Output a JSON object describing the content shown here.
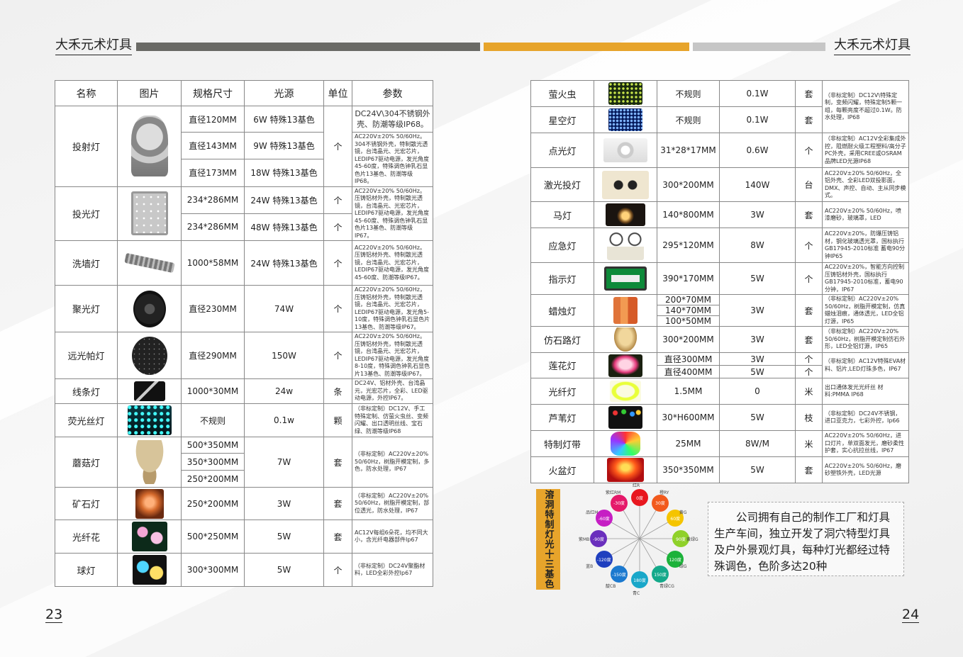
{
  "brand": "大禾元术灯具",
  "page_left": "23",
  "page_right": "24",
  "colors": {
    "accent": "#e7a42b",
    "bar_dark": "#6a6a66",
    "bar_light": "#c6c6c6"
  },
  "left_table": {
    "headers": [
      "名称",
      "图片",
      "规格尺寸",
      "光源",
      "单位",
      "参数"
    ],
    "rows": [
      {
        "name": "投射灯",
        "sizes": [
          "直径120MM",
          "直径143MM",
          "直径173MM"
        ],
        "sources": [
          "6W 特殊13基色",
          "9W 特殊13基色",
          "18W 特殊13基色"
        ],
        "unit": "个",
        "param_top": "DC24V\\304不锈钢外壳、防潮等级IP68。",
        "param": "AC220V±20% 50/60Hz。304不锈钢外壳，特制散光透镜，台湾晶元、光宏芯片，LEDIP67驱动电源，发光角度45-60度，特殊调色钟乳石显色片13基色、防潮等级IP68。"
      },
      {
        "name": "投光灯",
        "sizes": [
          "234*286MM",
          "234*286MM"
        ],
        "sources": [
          "24W 特殊13基色",
          "48W 特殊13基色"
        ],
        "unit": "个",
        "param": "AC220V±20% 50/60Hz。压铸铝材外壳，特制散光透镜，台湾晶元、光宏芯片，LEDIP67驱动电源，发光角度45-60度、特殊调色钟乳石显色片13基色、防潮等级IP67。"
      },
      {
        "name": "洗墙灯",
        "size": "1000*58MM",
        "source": "24W 特殊13基色",
        "unit": "个",
        "param": "AC220V±20% 50/60Hz。压铸铝材外壳、特制散光透镜，台湾晶元、光宏芯片，LEDIP67驱动电源，发光角度45-60度、防潮等级IP67。"
      },
      {
        "name": "聚光灯",
        "size": "直径230MM",
        "source": "74W",
        "unit": "个",
        "param": "AC220V±20% 50/60Hz，压铸铝材外壳，特制散光透镜，台湾晶元、光宏芯片，LEDIP67驱动电源，发光角5-10度，特殊调色钟乳石显色片13基色、防潮等级IP67。"
      },
      {
        "name": "远光帕灯",
        "size": "直径290MM",
        "source": "150W",
        "unit": "个",
        "param": "AC220V±20% 50/60Hz。压铸铝材外壳，特制散光透镜，台湾晶元、光宏芯片，LEDIP67驱动电源，发光角度8-10度，特殊调色钟乳石显色片13基色、防潮等级IP67。"
      },
      {
        "name": "线条灯",
        "size": "1000*30MM",
        "source": "24w",
        "unit": "条",
        "param": "DC24V、铝材外壳、台湾晶元，光宏芯片，全彩、LED驱动电源，外控IP67。"
      },
      {
        "name": "荧光丝灯",
        "size": "不规则",
        "source": "0.1w",
        "unit": "颗",
        "param": "（非标定制）DC12V、手工特殊定制、仿萤火虫丝、变频闪耀、出口透明丝线、宝石绿、防潮等级IP68"
      },
      {
        "name": "蘑菇灯",
        "sizes": [
          "500*350MM",
          "350*300MM",
          "250*200MM"
        ],
        "source": "7W",
        "unit": "套",
        "param": "（非标定制）AC220V±20% 50/60Hz，树脂开模定制，多色，防水处理，IP67"
      },
      {
        "name": "矿石灯",
        "size": "250*200MM",
        "source": "3W",
        "unit": "套",
        "param": "（非标定制）AC220V±20% 50/60Hz，树脂开模定制，部位透光，防水处理，IP67"
      },
      {
        "name": "光纤花",
        "size": "500*250MM",
        "source": "5W",
        "unit": "套",
        "param": "AC12V每组6朵花，均不同大小，含光纤电器部件Ip67"
      },
      {
        "name": "球灯",
        "size": "300*300MM",
        "source": "5W",
        "unit": "个",
        "param": "（非标定制）DC24V聚酯材料，LED全彩外控Ip67"
      }
    ]
  },
  "right_table": {
    "rows": [
      {
        "name": "萤火虫",
        "size": "不规则",
        "source": "0.1W",
        "unit": "套",
        "param": "（非标定制）DC12V\\特殊定制，变频闪耀，特殊定制5颗一组，每颗亮度不超过0.1W。防水处理，IP68"
      },
      {
        "name": "星空灯",
        "size": "不规则",
        "source": "0.1W",
        "unit": "套"
      },
      {
        "name": "点光灯",
        "size": "31*28*17MM",
        "source": "0.6W",
        "unit": "个",
        "param": "（非标定制）AC12V全彩集成外控，阻燃耐火级工程塑料/高分子PC外壳，采用CREE或OSRAM品牌LED光源IP68"
      },
      {
        "name": "激光投灯",
        "size": "300*200MM",
        "source": "140W",
        "unit": "台",
        "param": "AC220V±20% 50/60Hz，全铝外壳、全彩LED双投影面，DMX、声控、自动、主从同步模式。"
      },
      {
        "name": "马灯",
        "size": "140*800MM",
        "source": "3W",
        "unit": "套",
        "param": "AC220V±20% 50/60Hz，喷漆磨砂，玻璃罩，LED"
      },
      {
        "name": "应急灯",
        "size": "295*120MM",
        "source": "8W",
        "unit": "个",
        "param": "AC220V±20%，防爆压铸铝材，钢化玻璃透光罩，国标执行GB17945-2010标准 蓄电90分钟IP65"
      },
      {
        "name": "指示灯",
        "size": "390*170MM",
        "source": "5W",
        "unit": "个",
        "param": "AC220V±20%，智能方向控制压铸铝材外壳，国标执行GB17945-2010标准，蓄电90分钟，IP67"
      },
      {
        "name": "蜡烛灯",
        "sizes": [
          "200*70MM",
          "140*70MM",
          "100*50MM"
        ],
        "source": "3W",
        "unit": "套",
        "param": "（非标定制）AC220V±20% 50/60Hz，树脂开模定制，仿真蜡烛泪痕，通体透光，LED全铝灯源，IP65"
      },
      {
        "name": "仿石路灯",
        "size": "300*200MM",
        "source": "3W",
        "unit": "套",
        "param": "（非标定制）AC220V±20% 50/60Hz，树脂开模定制仿石外形，LED全铝灯源，IP65"
      },
      {
        "name": "莲花灯",
        "sizes": [
          "直径300MM",
          "直径400MM"
        ],
        "sources": [
          "3W",
          "5W"
        ],
        "units": [
          "个",
          "个"
        ],
        "param": "（非标定制）AC12V特殊EVA材料、铝片,LED灯珠多色，IP67"
      },
      {
        "name": "光纤灯",
        "size": "1.5MM",
        "source": "0",
        "unit": "米",
        "param": "出口通体发光光纤丝 材料:PMMA IP68"
      },
      {
        "name": "芦苇灯",
        "size": "30*H600MM",
        "source": "5W",
        "unit": "枝",
        "param": "（非标定制）DC24V不锈钢，进口亚克力，七彩外控，Ip66"
      },
      {
        "name": "特制灯带",
        "size": "25MM",
        "source": "8W/M",
        "unit": "米",
        "param": "AC220V±20% 50/60Hz，进口灯片，单双面发光，磨砂柔性护套，实心抗拉丝线，IP67"
      },
      {
        "name": "火盆灯",
        "size": "350*350MM",
        "source": "5W",
        "unit": "套",
        "param": "AC220V±20% 50/60Hz，磨砂塑铁外壳，LED光源"
      }
    ]
  },
  "color_section": {
    "tag": "溶洞特制灯光十三基色",
    "note": "公司拥有自己的制作工厂和灯具生产车间，独立开发了洞穴特型灯具及户外景观灯具，每种灯光都经过特殊调色，色阶多达20种",
    "wheel": [
      {
        "label": "红R",
        "inner": "0度",
        "color": "#e8171f"
      },
      {
        "label": "橙RY",
        "inner": "30度",
        "color": "#f25a1d"
      },
      {
        "label": "黄G",
        "inner": "60度",
        "color": "#f5c400"
      },
      {
        "label": "黄绿G",
        "inner": "90度",
        "color": "#8fd12a"
      },
      {
        "label": "绿G",
        "inner": "120度",
        "color": "#1cb23a"
      },
      {
        "label": "青绿CG",
        "inner": "150度",
        "color": "#14a98a"
      },
      {
        "label": "青C",
        "inner": "180度",
        "color": "#19a7c9"
      },
      {
        "label": "靛CB",
        "inner": "-150度",
        "color": "#1b79cf"
      },
      {
        "label": "蓝B",
        "inner": "-120度",
        "color": "#1f3fbf"
      },
      {
        "label": "紫MB",
        "inner": "-90度",
        "color": "#6a2fbd"
      },
      {
        "label": "品红M",
        "inner": "-60度",
        "color": "#c61ec4"
      },
      {
        "label": "紫红RM",
        "inner": "-30度",
        "color": "#e5196a"
      }
    ]
  }
}
